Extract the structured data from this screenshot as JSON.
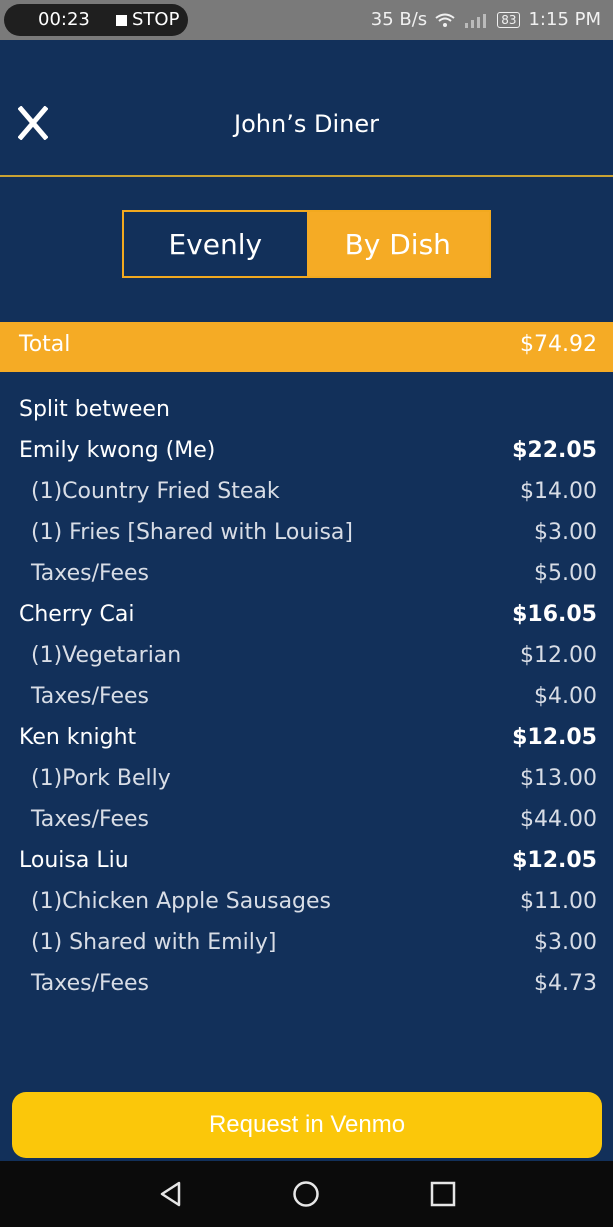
{
  "status_bar": {
    "recording_time": "00:23",
    "stop_label": "STOP",
    "network_speed": "35 B/s",
    "battery": "83",
    "clock": "1:15 PM"
  },
  "header": {
    "title": "John’s Diner",
    "close_icon": "close-icon"
  },
  "split_toggle": {
    "evenly_label": "Evenly",
    "by_dish_label": "By Dish",
    "selected": "By Dish"
  },
  "total": {
    "label": "Total",
    "amount": "$74.92"
  },
  "split_heading": "Split between",
  "people": [
    {
      "name": "Emily kwong (Me)",
      "amount": "$22.05",
      "items": [
        {
          "label": "(1)Country Fried Steak",
          "amount": "$14.00"
        },
        {
          "label": "(1) Fries [Shared with Louisa]",
          "amount": "$3.00"
        },
        {
          "label": "Taxes/Fees",
          "amount": "$5.00"
        }
      ]
    },
    {
      "name": "Cherry Cai",
      "amount": "$16.05",
      "items": [
        {
          "label": "(1)Vegetarian",
          "amount": "$12.00"
        },
        {
          "label": "Taxes/Fees",
          "amount": "$4.00"
        }
      ]
    },
    {
      "name": "Ken knight",
      "amount": "$12.05",
      "items": [
        {
          "label": "(1)Pork Belly",
          "amount": "$13.00"
        },
        {
          "label": "Taxes/Fees",
          "amount": "$44.00"
        }
      ]
    },
    {
      "name": "Louisa Liu",
      "amount": "$12.05",
      "items": [
        {
          "label": "(1)Chicken Apple Sausages",
          "amount": "$11.00"
        },
        {
          "label": "(1) Shared with Emily]",
          "amount": "$3.00"
        },
        {
          "label": "Taxes/Fees",
          "amount": "$4.73"
        }
      ]
    }
  ],
  "venmo_button": "Request in Venmo",
  "colors": {
    "background": "#12305a",
    "accent": "#f5ab25",
    "venmo_button": "#fbc70a"
  }
}
